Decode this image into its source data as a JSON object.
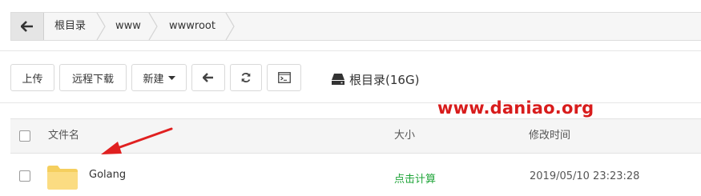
{
  "breadcrumb": {
    "back_icon": "arrow-left-icon",
    "items": [
      "根目录",
      "www",
      "wwwroot"
    ]
  },
  "toolbar": {
    "upload": "上传",
    "remote_download": "远程下载",
    "new": "新建",
    "new_icon": "caret-down-icon",
    "back_icon": "arrow-left-icon",
    "refresh_icon": "refresh-icon",
    "terminal_icon": "terminal-icon",
    "disk_icon": "hard-drive-icon",
    "disk_label": "根目录(16G)"
  },
  "watermark": "www.daniao.org",
  "table": {
    "columns": [
      "文件名",
      "大小",
      "修改时间"
    ],
    "rows": [
      {
        "name": "Golang",
        "size": "点击计算",
        "modified": "2019/05/10 23:23:28",
        "type_icon": "folder-icon"
      }
    ]
  },
  "colors": {
    "accent_green": "#20a53a",
    "watermark_red": "#d81c1c",
    "arrow_red": "#e02020",
    "folder_yellow": "#f9d76f"
  }
}
